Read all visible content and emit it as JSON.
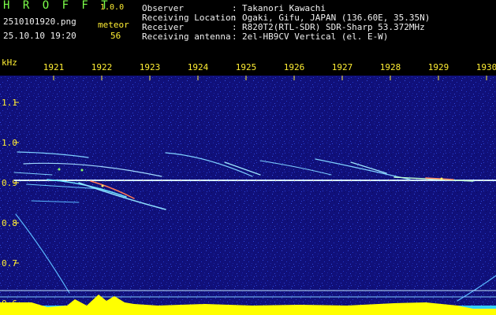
{
  "header": {
    "brand": "H R O F F T",
    "version": "1.0.0",
    "file_name": "2510101920.png",
    "timestamp": "25.10.10 19:20",
    "meteor_label": "meteor",
    "meteor_count": "56"
  },
  "station_info": [
    {
      "label": "Observer",
      "value": "Takanori Kawachi"
    },
    {
      "label": "Receiving Location",
      "value": "Ogaki, Gifu, JAPAN (136.60E, 35.35N)"
    },
    {
      "label": "Receiver",
      "value": "R820T2(RTL-SDR) SDR-Sharp 53.372MHz"
    },
    {
      "label": "Receiving antenna",
      "value": "2el-HB9CV Vertical (el. E-W)"
    }
  ],
  "axis": {
    "y_unit": "kHz",
    "time_ticks": [
      "1921",
      "1922",
      "1923",
      "1924",
      "1925",
      "1926",
      "1927",
      "1928",
      "1929",
      "1930"
    ],
    "freq_ticks": [
      "1.1",
      "1.0",
      "0.9",
      "0.8",
      "0.7",
      "0.6"
    ]
  },
  "colors": {
    "background": "#10107a",
    "text_yellow": "#ffee33",
    "text_green": "#7cff4a",
    "carrier": "#cfe8ff",
    "echo": "#9fd8ff",
    "bottom_bar": "#ffff00",
    "bottom_bar_alt": "#33d0ff"
  }
}
